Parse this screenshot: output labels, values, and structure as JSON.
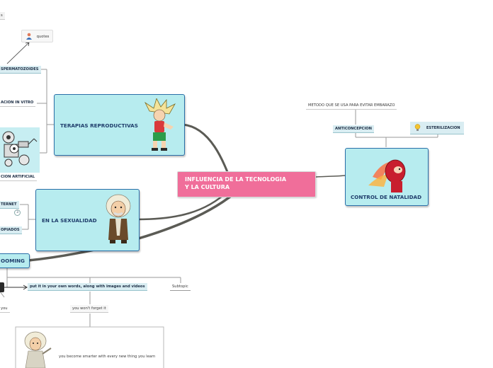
{
  "central": {
    "line1": "INFLUENCIA DE LA TECNOLOGIA",
    "line2": "Y LA  CULTURA"
  },
  "topics": {
    "terapias": "TERAPIAS REPRODUCTIVAS",
    "sexualidad": "EN LA SEXUALIDAD",
    "natalidad": "CONTROL DE NATALIDAD",
    "blooming": "OOMING"
  },
  "subtopics": {
    "quotes": "quotes",
    "top_left_partial": "s",
    "espermatozoides": "SPERMATOZOIDES",
    "in_vitro": "ACION IN VITRO",
    "artificial": "CION ARTIFICIAL",
    "internet": "TERNET",
    "internet_count": "3",
    "copiados": "OPIADOS",
    "metodo": "METODO QUE SE USA PARA EVITAR EMBARAZO",
    "anticoncepcion": "ANTICONCEPCION",
    "esterilizacion": "ESTERILIZACION",
    "put_it": "put it in your own words, along with images and videos",
    "subtopic": "Subtopic",
    "you": "you",
    "wont_forget": "you won't forget it",
    "smarter": "you become smarter with every new thing you learn"
  },
  "colors": {
    "topic_fill": "#b7ecef",
    "topic_border": "#2a6fa8",
    "central_fill": "#f06e9a",
    "connector": "#5b5b55"
  },
  "icons": [
    "person-icon",
    "lightbulb-icon",
    "cartoon-saiyan",
    "cartoon-einstein",
    "cartoon-flame-hero",
    "cartoon-robot",
    "cartoon-einstein-small"
  ]
}
